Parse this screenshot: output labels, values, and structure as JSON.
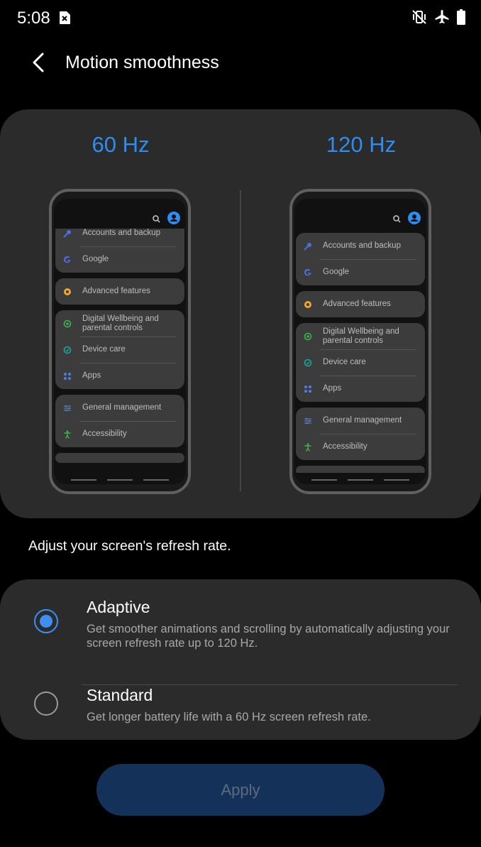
{
  "status_bar": {
    "time": "5:08",
    "icons": [
      "sim-error-icon",
      "vibrate-icon",
      "airplane-icon",
      "battery-icon"
    ]
  },
  "header": {
    "title": "Motion smoothness",
    "back_icon": "back-arrow-icon"
  },
  "preview": {
    "left_label": "60 Hz",
    "right_label": "120 Hz",
    "settings_items": [
      [
        "Accounts and backup",
        "Google"
      ],
      [
        "Advanced features"
      ],
      [
        "Digital Wellbeing and parental controls",
        "Device care",
        "Apps"
      ],
      [
        "General management",
        "Accessibility"
      ]
    ],
    "icon_colors": {
      "accounts": "#4a6ee0",
      "google": "#4a6ee0",
      "advanced": "#f0a530",
      "wellbeing": "#3cb64a",
      "device_care": "#18a89a",
      "apps": "#4a7ee8",
      "general": "#5a7ab8",
      "accessibility": "#3cb64a"
    }
  },
  "description": "Adjust your screen's refresh rate.",
  "options": [
    {
      "title": "Adaptive",
      "desc": "Get smoother animations and scrolling by automatically adjusting your screen refresh rate up to 120 Hz.",
      "selected": true
    },
    {
      "title": "Standard",
      "desc": "Get longer battery life with a 60 Hz screen refresh rate.",
      "selected": false
    }
  ],
  "apply_label": "Apply",
  "colors": {
    "accent": "#2e8df0",
    "card_bg": "#2b2b2b",
    "apply_bg": "#14315a"
  }
}
